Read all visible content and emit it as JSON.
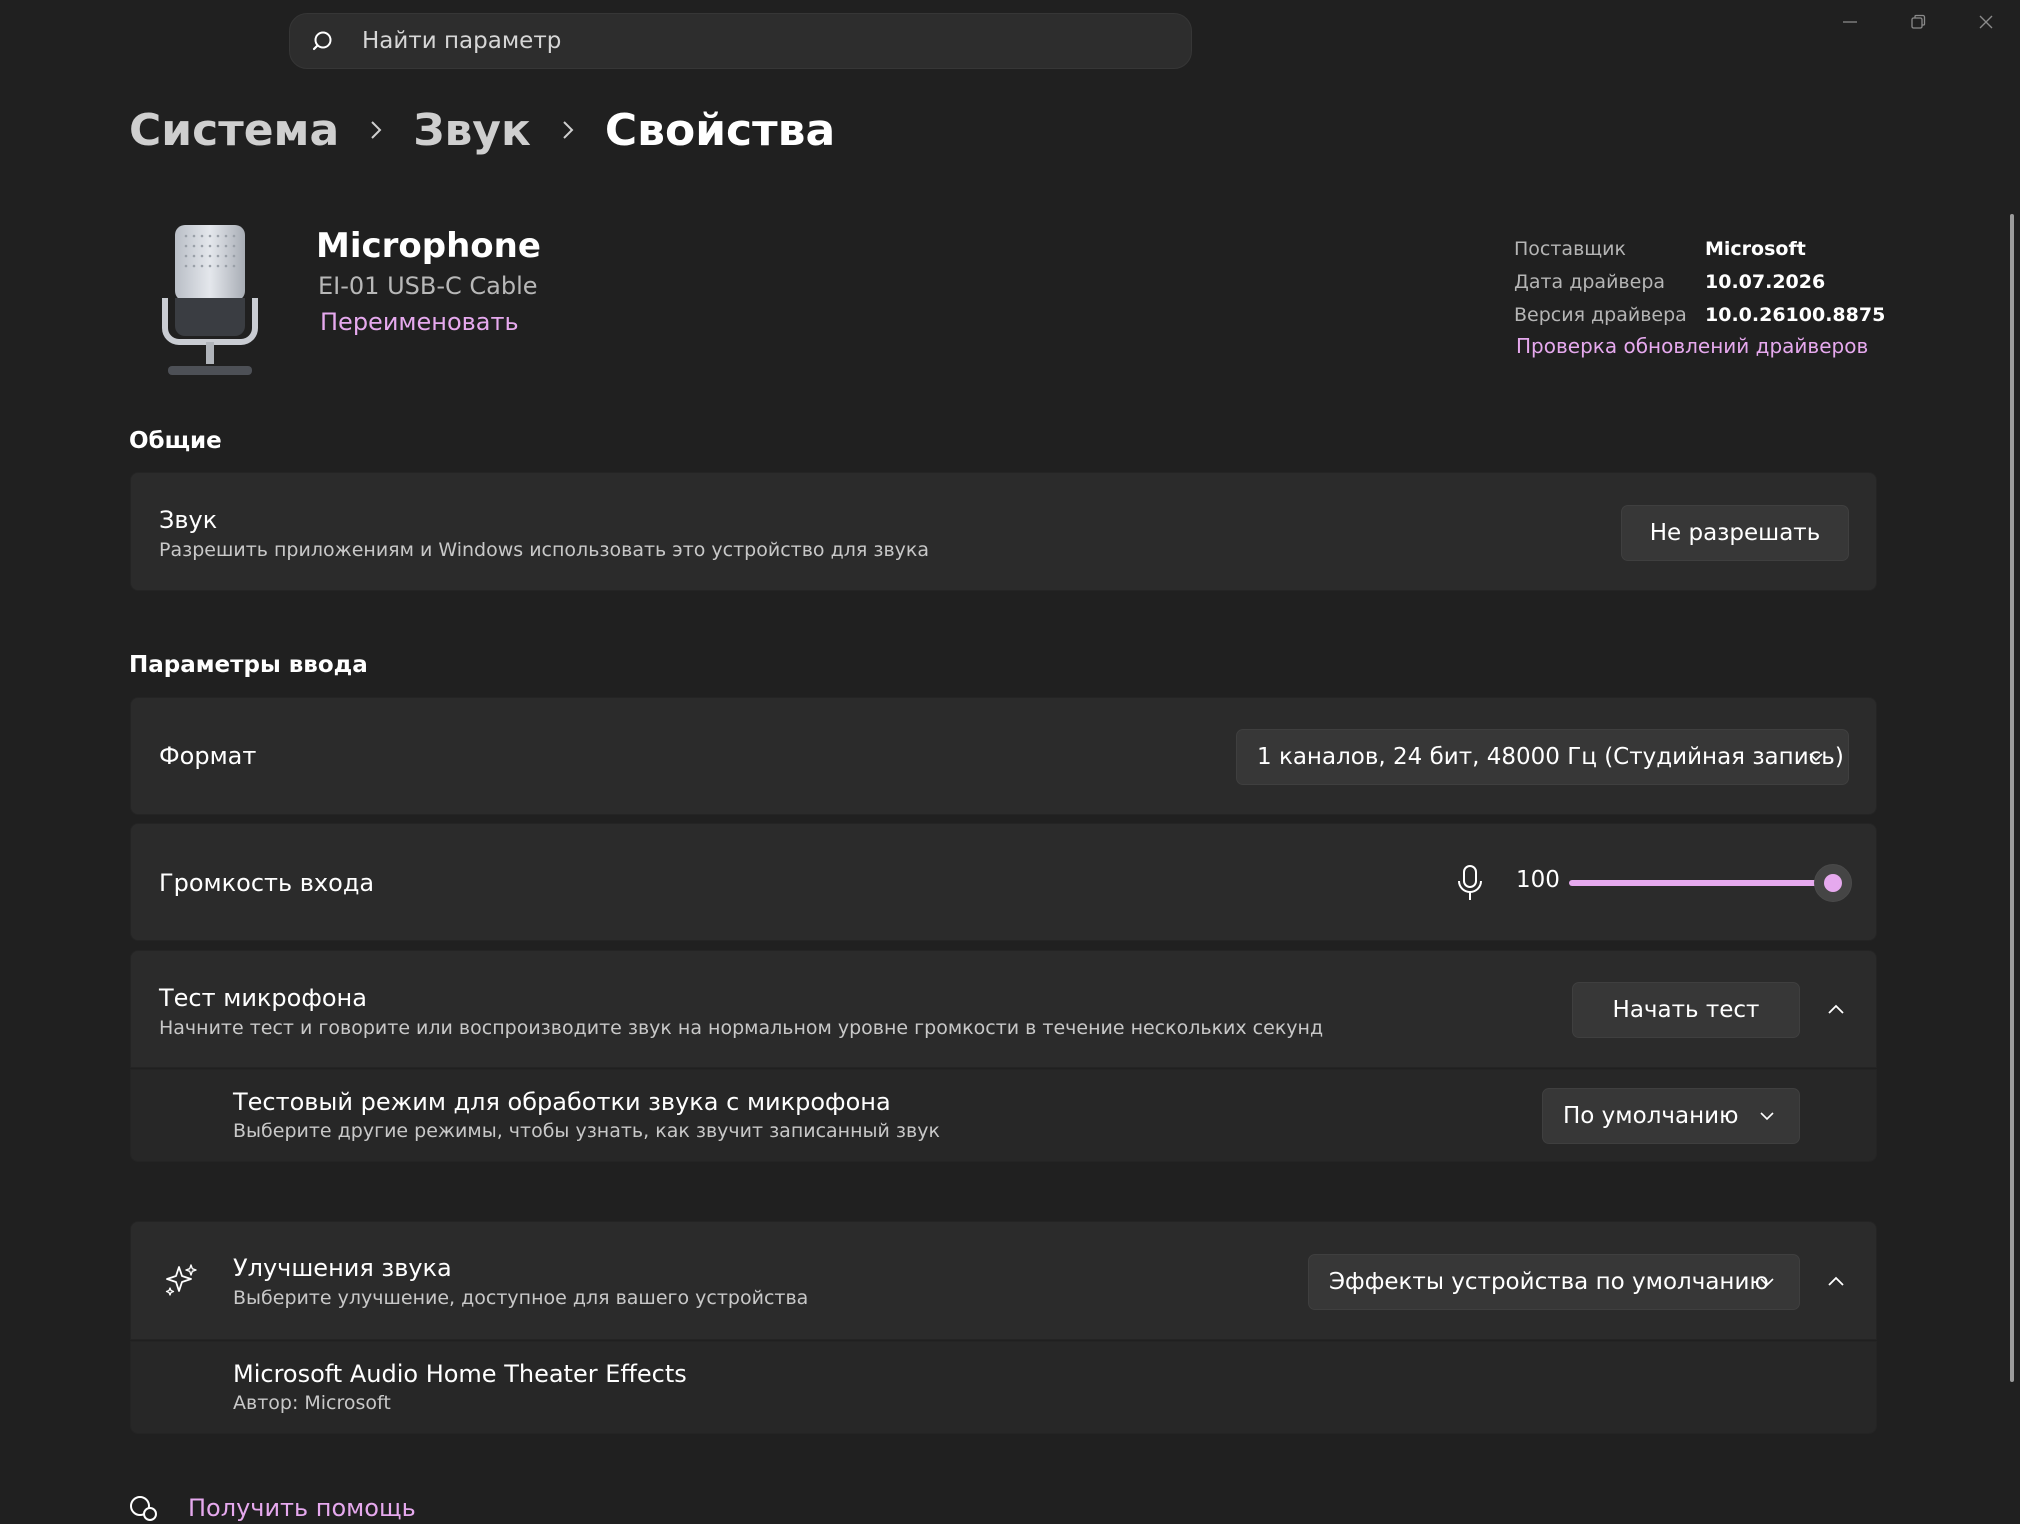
{
  "search": {
    "placeholder": "Найти параметр"
  },
  "breadcrumb": {
    "items": [
      "Система",
      "Звук",
      "Свойства"
    ]
  },
  "device": {
    "name": "Microphone",
    "model": "EI-01 USB-C Cable",
    "rename_label": "Переименовать"
  },
  "driver": {
    "rows": [
      {
        "label": "Поставщик",
        "value": "Microsoft"
      },
      {
        "label": "Дата драйвера",
        "value": "10.07.2026"
      },
      {
        "label": "Версия драйвера",
        "value": "10.0.26100.8875"
      }
    ],
    "update_link": "Проверка обновлений драйверов"
  },
  "general": {
    "section_title": "Общие",
    "sound": {
      "title": "Звук",
      "description": "Разрешить приложениям и Windows использовать это устройство для звука",
      "button": "Не разрешать"
    }
  },
  "input": {
    "section_title": "Параметры ввода",
    "format": {
      "title": "Формат",
      "value": "1 каналов, 24 бит, 48000 Гц (Студийная запись)"
    },
    "volume": {
      "title": "Громкость входа",
      "value": "100",
      "level_percent": 100
    },
    "mic_test": {
      "title": "Тест микрофона",
      "description": "Начните тест и говорите или воспроизводите звук на нормальном уровне громкости в течение нескольких секунд",
      "button": "Начать тест",
      "mode": {
        "title": "Тестовый режим для обработки звука с микрофона",
        "description": "Выберите другие режимы, чтобы узнать, как звучит записанный звук",
        "value": "По умолчанию"
      }
    }
  },
  "enhancements": {
    "title": "Улучшения звука",
    "description": "Выберите улучшение, доступное для вашего устройства",
    "value": "Эффекты устройства по умолчанию",
    "item": {
      "title": "Microsoft Audio Home Theater Effects",
      "author": "Автор: Microsoft"
    }
  },
  "help": {
    "label": "Получить помощь"
  },
  "colors": {
    "accent": "#e6a9ee",
    "background": "#202020",
    "card": "#2b2b2b"
  }
}
